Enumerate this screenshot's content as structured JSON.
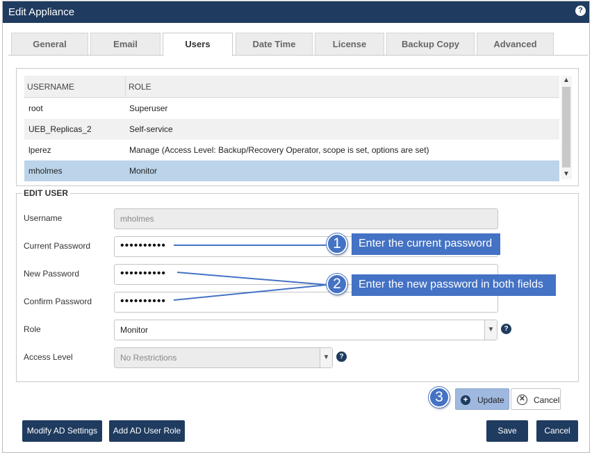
{
  "window": {
    "title": "Edit Appliance",
    "help_icon": "?"
  },
  "tabs": [
    {
      "label": "General"
    },
    {
      "label": "Email"
    },
    {
      "label": "Users",
      "active": true
    },
    {
      "label": "Date Time"
    },
    {
      "label": "License"
    },
    {
      "label": "Backup Copy"
    },
    {
      "label": "Advanced"
    }
  ],
  "users_table": {
    "columns": [
      "USERNAME",
      "ROLE"
    ],
    "rows": [
      {
        "username": "root",
        "role": "Superuser"
      },
      {
        "username": "UEB_Replicas_2",
        "role": "Self-service"
      },
      {
        "username": "lperez",
        "role": "Manage (Access Level: Backup/Recovery Operator, scope is set, options are set)"
      },
      {
        "username": "mholmes",
        "role": "Monitor",
        "selected": true
      }
    ]
  },
  "edit_user": {
    "legend": "EDIT USER",
    "username_label": "Username",
    "username_value": "mholmes",
    "current_password_label": "Current Password",
    "current_password_value": "••••••••••",
    "new_password_label": "New Password",
    "new_password_value": "••••••••••",
    "confirm_password_label": "Confirm Password",
    "confirm_password_value": "••••••••••",
    "role_label": "Role",
    "role_value": "Monitor",
    "access_level_label": "Access Level",
    "access_level_value": "No Restrictions"
  },
  "callouts": [
    {
      "number": "1",
      "text": "Enter the current password"
    },
    {
      "number": "2",
      "text": "Enter the new password in both fields"
    },
    {
      "number": "3",
      "text": ""
    }
  ],
  "actions": {
    "update_label": "Update",
    "cancel_edit_label": "Cancel",
    "modify_ad_label": "Modify AD Settings",
    "add_ad_role_label": "Add AD User Role",
    "save_label": "Save",
    "cancel_label": "Cancel"
  },
  "colors": {
    "titlebar": "#1f3b5f",
    "callout": "#4472c4",
    "selected_row": "#bcd4ea"
  }
}
